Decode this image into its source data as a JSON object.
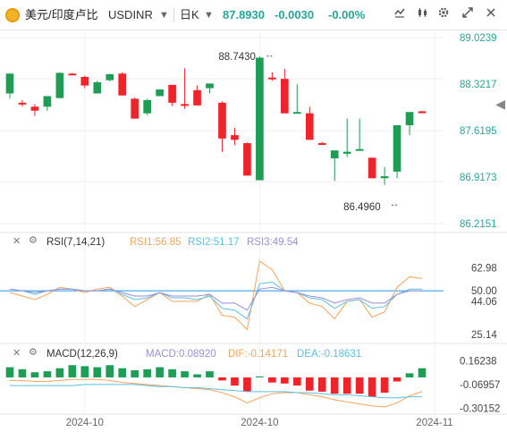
{
  "header": {
    "symbol_title": "美元/印度卢比",
    "symbol_code": "USDINR",
    "timeframe": "日K",
    "last_price": "87.8930",
    "change": "-0.0030",
    "change_pct": "-0.00%",
    "price_color": "#26a69a"
  },
  "colors": {
    "up": "#26a69a",
    "down": "#ef232a",
    "up_candle": "#1f9d55",
    "rsi1": "#f7a35c",
    "rsi2": "#5bc0de",
    "rsi3": "#9b8fd6",
    "midline": "#2196f3",
    "macd_dif": "#f7a35c",
    "macd_dea": "#5bc0de"
  },
  "rsi_panel": {
    "label": "RSI(7,14,21)",
    "rsi1": "RSI1:56.85",
    "rsi2": "RSI2:51.17",
    "rsi3": "RSI3:49.54"
  },
  "macd_panel": {
    "label": "MACD(12,26,9)",
    "macd": "MACD:0.08920",
    "dif": "DIF:-0.14171",
    "dea": "DEA:-0.18631"
  },
  "icons": [
    "coin-icon",
    "drawing-icon",
    "indicator-icon",
    "settings-icon",
    "fullscreen-icon",
    "close-icon",
    "eye-icon",
    "gear-icon",
    "arrow-right-icon"
  ],
  "chart_data": [
    {
      "type": "candlestick",
      "title": "美元/印度卢比 USDINR 日K",
      "price_axis_labels": [
        "89.0239",
        "88.3217",
        "87.6195",
        "86.9173",
        "86.2151"
      ],
      "ylim": [
        86.2151,
        89.0239
      ],
      "annotations": [
        {
          "text": "88.7430",
          "value": 88.743,
          "index": 21
        },
        {
          "text": "86.4960",
          "value": 86.496,
          "index": 31
        }
      ],
      "x_tick_labels": [
        "2024-10",
        "2024-10",
        "2024-11"
      ],
      "x_tick_index": [
        6,
        20,
        34
      ],
      "candles": [
        {
          "o": 88.18,
          "h": 88.48,
          "l": 88.1,
          "c": 88.48
        },
        {
          "o": 88.04,
          "h": 88.08,
          "l": 87.98,
          "c": 88.02
        },
        {
          "o": 87.98,
          "h": 88.02,
          "l": 87.84,
          "c": 87.92
        },
        {
          "o": 87.98,
          "h": 88.14,
          "l": 87.92,
          "c": 88.14
        },
        {
          "o": 88.11,
          "h": 88.5,
          "l": 88.11,
          "c": 88.49
        },
        {
          "o": 88.48,
          "h": 88.49,
          "l": 88.47,
          "c": 88.47
        },
        {
          "o": 88.43,
          "h": 88.45,
          "l": 88.26,
          "c": 88.3
        },
        {
          "o": 88.18,
          "h": 88.37,
          "l": 88.18,
          "c": 88.35
        },
        {
          "o": 88.38,
          "h": 88.48,
          "l": 88.36,
          "c": 88.47
        },
        {
          "o": 88.48,
          "h": 88.5,
          "l": 88.15,
          "c": 88.15
        },
        {
          "o": 88.1,
          "h": 88.12,
          "l": 87.8,
          "c": 87.8
        },
        {
          "o": 87.88,
          "h": 88.1,
          "l": 87.85,
          "c": 88.08
        },
        {
          "o": 88.14,
          "h": 88.24,
          "l": 88.14,
          "c": 88.24
        },
        {
          "o": 88.31,
          "h": 88.31,
          "l": 87.99,
          "c": 88.04
        },
        {
          "o": 88.02,
          "h": 88.56,
          "l": 87.95,
          "c": 88.0
        },
        {
          "o": 88.23,
          "h": 88.3,
          "l": 88.0,
          "c": 88.0
        },
        {
          "o": 88.26,
          "h": 88.33,
          "l": 88.18,
          "c": 88.33
        },
        {
          "o": 88.04,
          "h": 88.06,
          "l": 87.3,
          "c": 87.5
        },
        {
          "o": 87.55,
          "h": 87.66,
          "l": 87.4,
          "c": 87.48
        },
        {
          "o": 87.43,
          "h": 87.44,
          "l": 86.94,
          "c": 86.94
        },
        {
          "o": 86.87,
          "h": 88.74,
          "l": 86.87,
          "c": 88.72
        },
        {
          "o": 88.42,
          "h": 88.5,
          "l": 88.37,
          "c": 88.4
        },
        {
          "o": 88.4,
          "h": 88.55,
          "l": 87.88,
          "c": 87.88
        },
        {
          "o": 87.88,
          "h": 88.32,
          "l": 87.88,
          "c": 87.9
        },
        {
          "o": 87.88,
          "h": 87.98,
          "l": 87.48,
          "c": 87.48
        },
        {
          "o": 87.43,
          "h": 87.45,
          "l": 87.42,
          "c": 87.42
        },
        {
          "o": 87.2,
          "h": 87.32,
          "l": 86.86,
          "c": 87.32
        },
        {
          "o": 87.27,
          "h": 87.8,
          "l": 87.22,
          "c": 87.3
        },
        {
          "o": 87.34,
          "h": 87.8,
          "l": 87.33,
          "c": 87.34
        },
        {
          "o": 87.21,
          "h": 87.21,
          "l": 86.9,
          "c": 86.9
        },
        {
          "o": 86.9,
          "h": 87.07,
          "l": 86.8,
          "c": 86.93
        },
        {
          "o": 87.0,
          "h": 87.7,
          "l": 86.9,
          "c": 87.7
        },
        {
          "o": 87.7,
          "h": 87.8,
          "l": 87.55,
          "c": 87.9
        },
        {
          "o": 87.91,
          "h": 87.92,
          "l": 87.88,
          "c": 87.89
        }
      ]
    },
    {
      "type": "line",
      "title": "RSI(7,14,21)",
      "y_axis_labels": [
        "62.98",
        "50.00",
        "44.06",
        "25.14"
      ],
      "ylim": [
        20,
        72
      ],
      "midline": 50,
      "series": [
        {
          "name": "RSI1",
          "values": [
            49,
            47,
            45,
            48,
            52,
            51,
            49,
            51,
            52,
            47,
            41,
            45,
            49,
            44,
            44,
            44,
            48,
            36,
            35,
            28,
            67,
            62,
            50,
            49,
            43,
            41,
            34,
            44,
            45,
            35,
            38,
            52,
            58,
            57
          ]
        },
        {
          "name": "RSI2",
          "values": [
            51,
            50,
            48,
            50,
            51,
            51,
            50,
            50,
            51,
            48,
            45,
            46,
            49,
            46,
            46,
            45,
            47,
            40,
            39,
            34,
            54,
            55,
            50,
            49,
            46,
            45,
            40,
            44,
            45,
            40,
            41,
            48,
            51,
            51
          ]
        },
        {
          "name": "RSI3",
          "values": [
            51,
            50,
            49,
            50,
            51,
            51,
            50,
            50,
            51,
            49,
            47,
            47,
            49,
            47,
            47,
            47,
            48,
            43,
            43,
            39,
            51,
            52,
            50,
            49,
            47,
            46,
            43,
            45,
            46,
            43,
            43,
            48,
            50,
            50
          ]
        }
      ]
    },
    {
      "type": "bar",
      "title": "MACD(12,26,9)",
      "y_axis_labels": [
        "0.16238",
        "-0.06957",
        "-0.30152"
      ],
      "ylim": [
        -0.36,
        0.21
      ],
      "histogram": [
        0.1,
        0.08,
        0.05,
        0.06,
        0.09,
        0.12,
        0.11,
        0.1,
        0.12,
        0.09,
        0.07,
        0.08,
        0.1,
        0.08,
        0.06,
        0.03,
        0.06,
        -0.03,
        -0.08,
        -0.14,
        0.01,
        -0.05,
        -0.06,
        -0.08,
        -0.13,
        -0.14,
        -0.16,
        -0.16,
        -0.16,
        -0.19,
        -0.15,
        -0.04,
        0.04,
        0.09
      ],
      "series": [
        {
          "name": "DIF",
          "values": [
            -0.03,
            -0.03,
            -0.04,
            -0.04,
            -0.03,
            -0.02,
            -0.02,
            -0.02,
            -0.03,
            -0.05,
            -0.06,
            -0.07,
            -0.08,
            -0.09,
            -0.1,
            -0.11,
            -0.12,
            -0.15,
            -0.19,
            -0.25,
            -0.2,
            -0.16,
            -0.15,
            -0.15,
            -0.17,
            -0.19,
            -0.22,
            -0.24,
            -0.26,
            -0.28,
            -0.29,
            -0.25,
            -0.18,
            -0.14
          ]
        },
        {
          "name": "DEA",
          "values": [
            -0.08,
            -0.08,
            -0.08,
            -0.08,
            -0.08,
            -0.08,
            -0.07,
            -0.07,
            -0.07,
            -0.07,
            -0.07,
            -0.08,
            -0.09,
            -0.09,
            -0.1,
            -0.1,
            -0.11,
            -0.12,
            -0.13,
            -0.14,
            -0.14,
            -0.14,
            -0.14,
            -0.15,
            -0.15,
            -0.16,
            -0.17,
            -0.17,
            -0.18,
            -0.19,
            -0.2,
            -0.2,
            -0.19,
            -0.19
          ]
        }
      ]
    }
  ]
}
